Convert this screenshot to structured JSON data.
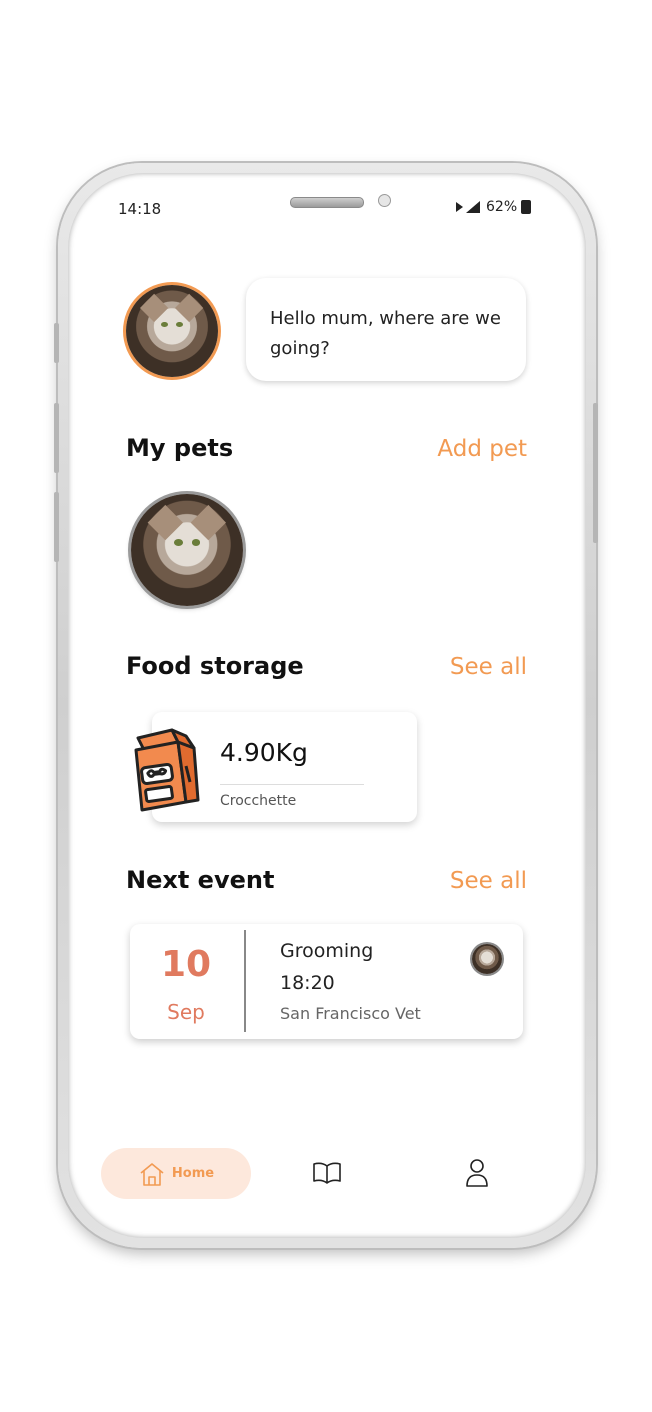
{
  "status_bar": {
    "time": "14:18",
    "battery": "62%"
  },
  "greeting": {
    "message": "Hello mum, where are we going?"
  },
  "my_pets": {
    "title": "My pets",
    "action": "Add pet"
  },
  "food_storage": {
    "title": "Food storage",
    "action": "See all",
    "item": {
      "amount": "4.90Kg",
      "name": "Crocchette"
    }
  },
  "next_event": {
    "title": "Next event",
    "action": "See all",
    "event": {
      "day": "10",
      "month": "Sep",
      "name": "Grooming",
      "time": "18:20",
      "place": "San Francisco Vet"
    }
  },
  "bottom_nav": {
    "items": [
      {
        "label": "Home",
        "icon": "home-icon",
        "active": true
      },
      {
        "label": "",
        "icon": "book-icon",
        "active": false
      },
      {
        "label": "",
        "icon": "user-icon",
        "active": false
      }
    ]
  },
  "colors": {
    "accent": "#f29a52",
    "event_date": "#e07a5f",
    "nav_active_bg": "#fde8dc"
  }
}
